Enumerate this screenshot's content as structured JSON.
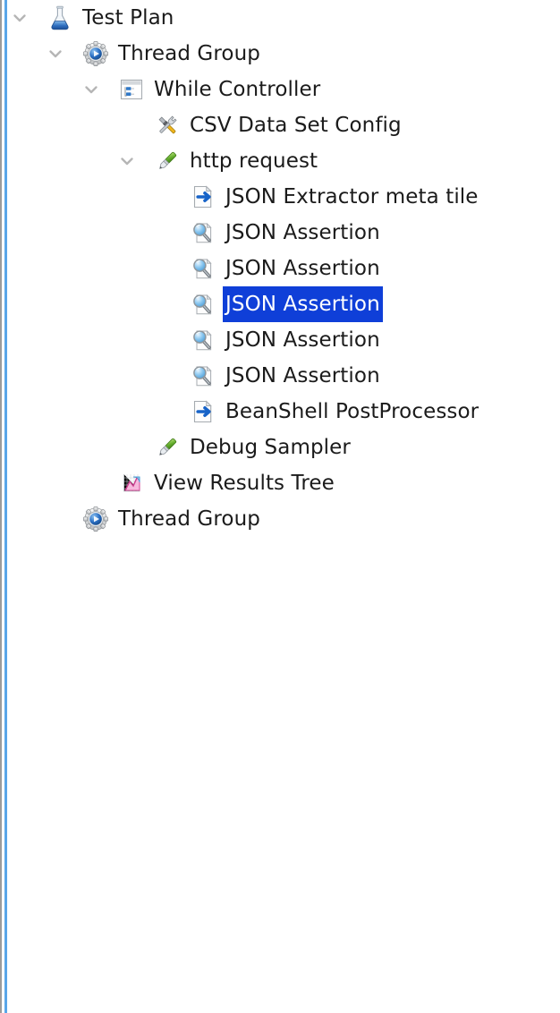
{
  "panel": {
    "name": "jmeter-test-plan-tree",
    "background": "#ffffff",
    "gutter_gray": "#9b9b9b",
    "gutter_blue": "#5aa6e8",
    "selection_background": "#0f3fd8",
    "selection_text": "#ffffff",
    "text_color": "#1b1b1b"
  },
  "tree": {
    "rows": [
      {
        "label": "Test Plan",
        "icon": "test-plan-flask-icon",
        "depth": 0,
        "toggle": "chevron-down-icon",
        "expanded": true,
        "selected": false
      },
      {
        "label": "Thread Group",
        "icon": "thread-group-gear-icon",
        "depth": 1,
        "toggle": "chevron-down-icon",
        "expanded": true,
        "selected": false
      },
      {
        "label": "While Controller",
        "icon": "while-controller-icon",
        "depth": 2,
        "toggle": "chevron-down-icon",
        "expanded": true,
        "selected": false
      },
      {
        "label": "CSV Data Set Config",
        "icon": "config-tools-icon",
        "depth": 3,
        "toggle": "none",
        "expanded": false,
        "selected": false
      },
      {
        "label": "http request",
        "icon": "sampler-pencil-icon",
        "depth": 3,
        "toggle": "chevron-down-icon",
        "expanded": true,
        "selected": false
      },
      {
        "label": "JSON Extractor meta tile",
        "icon": "postprocessor-arrow-icon",
        "depth": 4,
        "toggle": "none",
        "expanded": false,
        "selected": false
      },
      {
        "label": "JSON Assertion",
        "icon": "assertion-magnifier-icon",
        "depth": 4,
        "toggle": "none",
        "expanded": false,
        "selected": false
      },
      {
        "label": "JSON Assertion",
        "icon": "assertion-magnifier-icon",
        "depth": 4,
        "toggle": "none",
        "expanded": false,
        "selected": false
      },
      {
        "label": "JSON Assertion",
        "icon": "assertion-magnifier-icon",
        "depth": 4,
        "toggle": "none",
        "expanded": false,
        "selected": true
      },
      {
        "label": "JSON Assertion",
        "icon": "assertion-magnifier-icon",
        "depth": 4,
        "toggle": "none",
        "expanded": false,
        "selected": false
      },
      {
        "label": "JSON Assertion",
        "icon": "assertion-magnifier-icon",
        "depth": 4,
        "toggle": "none",
        "expanded": false,
        "selected": false
      },
      {
        "label": "BeanShell PostProcessor",
        "icon": "postprocessor-arrow-icon",
        "depth": 4,
        "toggle": "none",
        "expanded": false,
        "selected": false
      },
      {
        "label": "Debug Sampler",
        "icon": "sampler-pencil-icon",
        "depth": 3,
        "toggle": "none",
        "expanded": false,
        "selected": false
      },
      {
        "label": "View Results Tree",
        "icon": "listener-chart-icon",
        "depth": 2,
        "toggle": "none",
        "expanded": false,
        "selected": false
      },
      {
        "label": "Thread Group",
        "icon": "thread-group-gear-icon",
        "depth": 1,
        "toggle": "none",
        "expanded": false,
        "selected": false
      }
    ]
  }
}
